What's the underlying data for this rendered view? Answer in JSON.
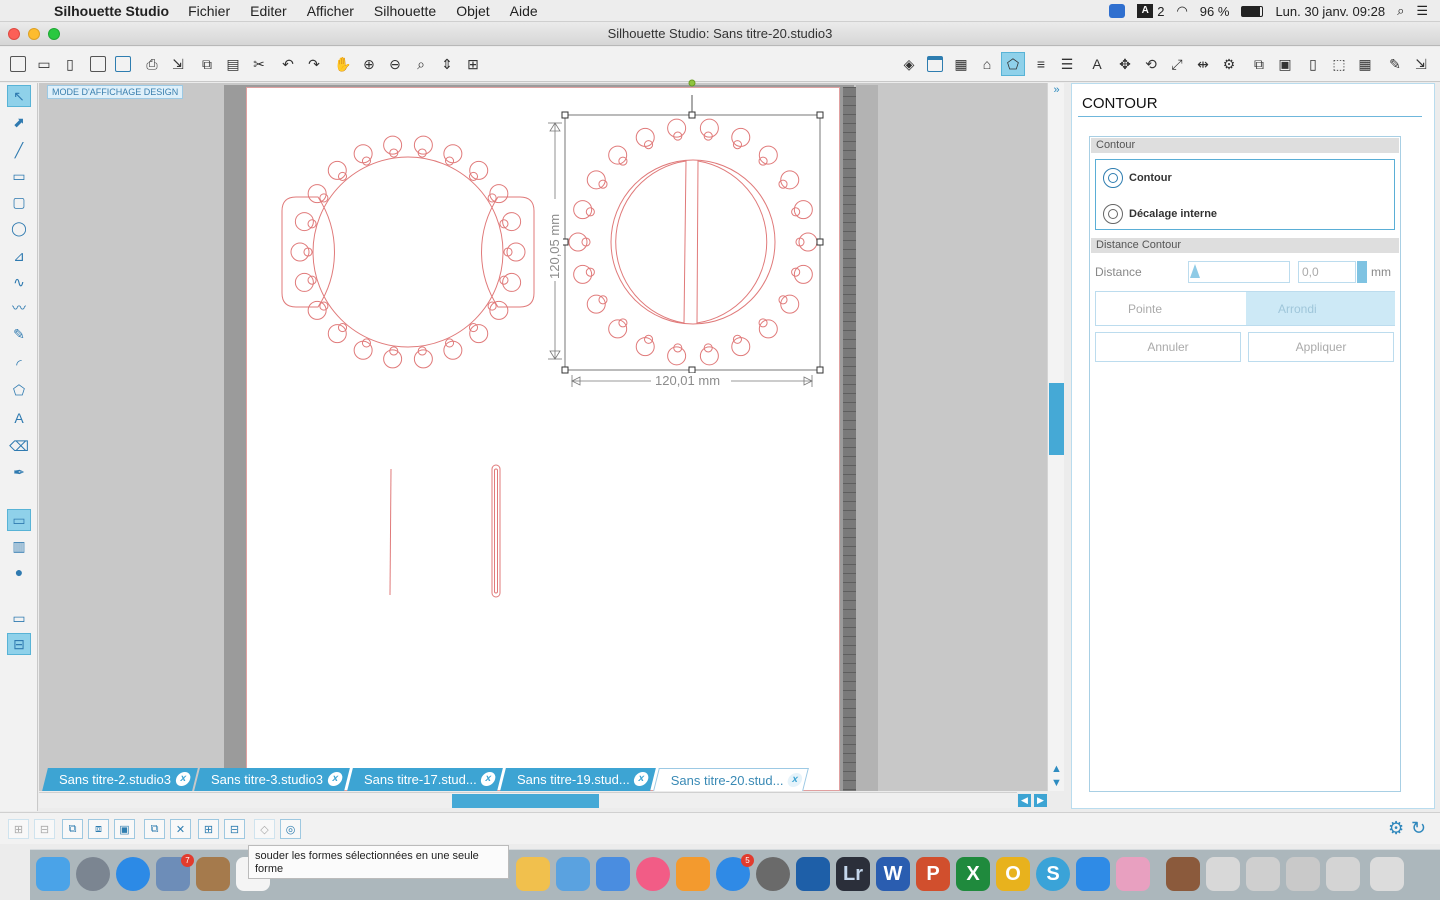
{
  "menubar": {
    "app_name": "Silhouette Studio",
    "menus": [
      "Fichier",
      "Editer",
      "Afficher",
      "Silhouette",
      "Objet",
      "Aide"
    ],
    "status": {
      "input_source": "2",
      "battery": "96 %",
      "datetime": "Lun. 30 janv.  09:28"
    }
  },
  "window": {
    "title": "Silhouette Studio: Sans titre-20.studio3"
  },
  "canvas": {
    "mode_label": "MODE D'AFFICHAGE DESIGN",
    "height_dimension": "120,05 mm",
    "width_dimension": "120,01 mm"
  },
  "tabs": [
    {
      "label": "Sans titre-2.studio3",
      "close": "x"
    },
    {
      "label": "Sans titre-3.studio3",
      "close": "x"
    },
    {
      "label": "Sans titre-17.stud...",
      "close": "x"
    },
    {
      "label": "Sans titre-19.stud...",
      "close": "x"
    },
    {
      "label": "Sans titre-20.stud...",
      "close": "x"
    }
  ],
  "panel": {
    "title": "CONTOUR",
    "section_contour": "Contour",
    "option_contour": "Contour",
    "option_inner": "Décalage interne",
    "section_distance": "Distance Contour",
    "distance_label": "Distance",
    "distance_value": "0,0",
    "distance_unit": "mm",
    "corner_sharp": "Pointe",
    "corner_round": "Arrondi",
    "cancel": "Annuler",
    "apply": "Appliquer"
  },
  "tooltip": {
    "text": "souder les formes sélectionnées en une seule forme"
  },
  "dock": {
    "mail_badge": "7",
    "appstore_badge": "5"
  },
  "colors": {
    "accent": "#3da4d3",
    "cut_line": "#e07a7a"
  }
}
